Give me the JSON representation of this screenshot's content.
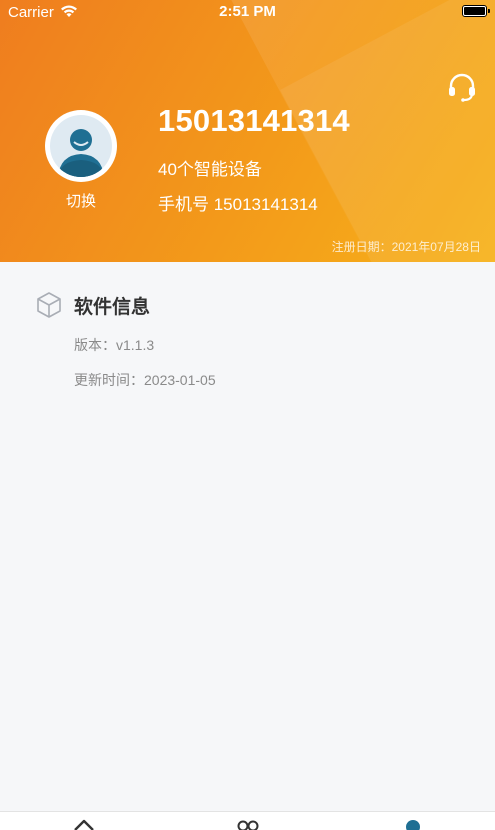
{
  "status_bar": {
    "carrier": "Carrier",
    "time": "2:51 PM"
  },
  "profile": {
    "title": "15013141314",
    "device_count": "40个智能设备",
    "phone_line": "手机号 15013141314",
    "switch_label": "切换",
    "register_date": "注册日期：2021年07月28日"
  },
  "software_info": {
    "title": "软件信息",
    "version": "版本：v1.1.3",
    "updated": "更新时间：2023-01-05"
  },
  "colors": {
    "header_gradient_start": "#ef7d1f",
    "header_gradient_end": "#f7b21a",
    "avatar_blue": "#1f6f93",
    "page_background": "#f6f7f9"
  },
  "icons": {
    "support": "headset-icon",
    "avatar": "user-avatar-icon",
    "section": "cube-icon",
    "tab_home": "home-icon",
    "tab_devices": "devices-icon",
    "tab_profile": "profile-icon"
  }
}
